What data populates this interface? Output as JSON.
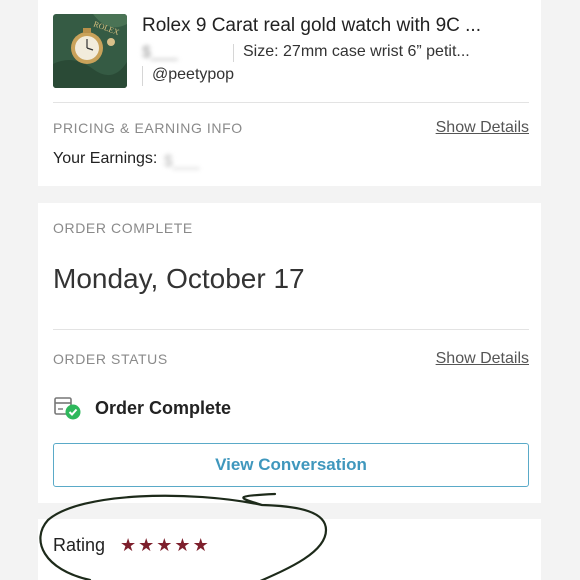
{
  "item": {
    "title": "Rolex 9 Carat real gold watch with 9C ...",
    "price": "$___",
    "size": "Size: 27mm case wrist 6” petit...",
    "seller": "@peetypop",
    "thumb_text": "ROLEX"
  },
  "pricing": {
    "heading": "PRICING & EARNING INFO",
    "show_details": "Show Details",
    "earnings_label": "Your Earnings:",
    "earnings_value": "$___"
  },
  "order": {
    "heading": "ORDER COMPLETE",
    "date": "Monday, October 17",
    "status_heading": "ORDER STATUS",
    "show_details": "Show Details",
    "status_label": "Order Complete",
    "view_conversation": "View Conversation"
  },
  "rating": {
    "label": "Rating",
    "stars": 5,
    "star_glyph": "★"
  },
  "colors": {
    "star": "#7d1f2c",
    "button_accent": "#3f97bd",
    "status_check": "#2eb85c",
    "ink_circle": "#1d2a1a"
  }
}
